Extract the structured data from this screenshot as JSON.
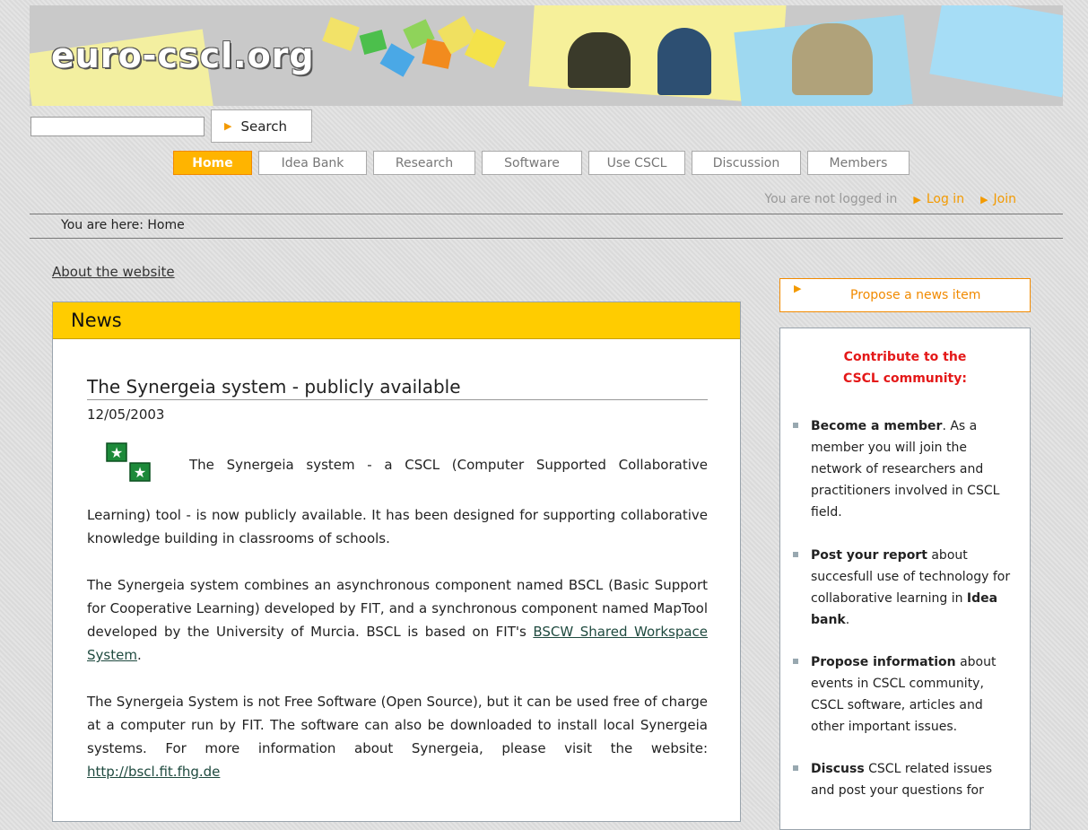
{
  "banner": {
    "logo_text": "euro-cscl.org"
  },
  "search": {
    "input_value": "",
    "button_label": "Search"
  },
  "nav": {
    "tabs": [
      {
        "label": "Home",
        "active": true
      },
      {
        "label": "Idea Bank",
        "active": false
      },
      {
        "label": "Research",
        "active": false
      },
      {
        "label": "Software",
        "active": false
      },
      {
        "label": "Use CSCL",
        "active": false
      },
      {
        "label": "Discussion",
        "active": false
      },
      {
        "label": "Members",
        "active": false
      }
    ]
  },
  "login": {
    "status": "You are not logged in",
    "login_label": "Log in",
    "join_label": "Join"
  },
  "breadcrumb": "You are here: Home",
  "about_link": "About the website",
  "news": {
    "heading": "News",
    "article": {
      "title": "The Synergeia system - publicly available",
      "date": "12/05/2003",
      "p1_first_line": "The Synergeia system - a CSCL (Computer Supported Collaborative",
      "p1_rest": "Learning) tool - is now publicly available. It has been designed for supporting collaborative knowledge building in classrooms of schools.",
      "p2_text": "The Synergeia system combines an asynchronous component named BSCL (Basic Support for Cooperative Learning) developed by FIT, and a synchronous component named MapTool developed by the University of Murcia. BSCL is based on FIT's ",
      "p2_link": "BSCW Shared Workspace System",
      "p2_end": ".",
      "p3_text": "The Synergeia System is not Free Software (Open Source), but it can be used free of charge at a computer run by FIT. The software can also be downloaded to install local Synergeia systems. For more information about Synergeia, please visit the website: ",
      "p3_link": "http://bscl.fit.fhg.de"
    }
  },
  "sidebar": {
    "propose_label": "Propose a news item",
    "contribute_title": "Contribute to the CSCL community:",
    "items": [
      {
        "bold": "Become a member",
        "text": ". As a member you will join the network of researchers and practitioners involved in CSCL field."
      },
      {
        "bold": "Post your report",
        "text": " about succesfull use of technology for collaborative learning in ",
        "bold2": "Idea bank",
        "text2": "."
      },
      {
        "bold": "Propose information",
        "text": " about events in CSCL community, CSCL software, articles and other important issues."
      },
      {
        "bold": "Discuss",
        "text": " CSCL related issues and post your questions for"
      }
    ]
  },
  "colors": {
    "accent_orange": "#f18a00",
    "news_header": "#ffcc00",
    "contribute_title": "#e41818"
  }
}
